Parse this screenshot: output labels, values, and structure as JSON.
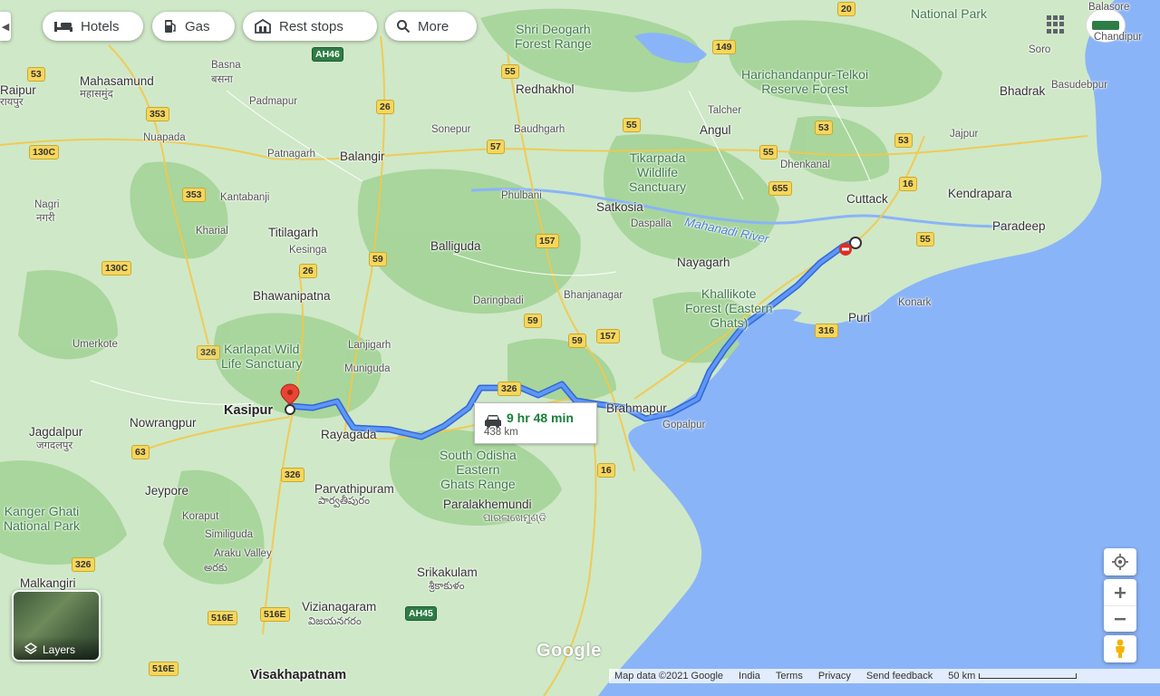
{
  "colors": {
    "land": "#cfe8c8",
    "forest": "#9fd08e",
    "sea": "#8ab4f8",
    "route": "#4a80f5",
    "park_text": "#3d7a4a",
    "duration_green": "#188038"
  },
  "chips": [
    {
      "label": "Hotels",
      "icon": "bed-icon"
    },
    {
      "label": "Gas",
      "icon": "gas-pump-icon"
    },
    {
      "label": "Rest stops",
      "icon": "rest-stop-icon"
    },
    {
      "label": "More",
      "icon": "search-icon"
    }
  ],
  "route": {
    "duration": "9 hr 48 min",
    "distance": "438 km",
    "origin": "Kasipur"
  },
  "places": {
    "kasipur": "Kasipur",
    "rayagada": "Rayagada",
    "brahmapur": "Brahmapur",
    "gopalpur": "Gopalpur",
    "jagdalpur": "Jagdalpur",
    "jagdalpur_local": "जगदलपुर",
    "nowrangpur": "Nowrangpur",
    "jeypore": "Jeypore",
    "koraput": "Koraput",
    "similiguda": "Similiguda",
    "araku_valley": "Araku Valley",
    "araku_local": "అరకు",
    "malkangiri": "Malkangiri",
    "parvathipuram": "Parvathipuram",
    "parvathipuram_local": "పార్వతీపురం",
    "paralakhemundi": "Paralakhemundi",
    "paralakhemundi_local": "ପାରଳାଖେମୁଣ୍ଡି",
    "srikakulam": "Srikakulam",
    "srikakulam_local": "శ్రీకాకుళం",
    "vizianagaram": "Vizianagaram",
    "vizianagaram_local": "విజయనగరం",
    "visakhapatnam": "Visakhapatnam",
    "bhawanipatna": "Bhawanipatna",
    "umerkote": "Umerkote",
    "kharias": "Kharial",
    "titilagarh": "Titilagarh",
    "kesinga": "Kesinga",
    "kantabanji": "Kantabanji",
    "patnagarh": "Patnagarh",
    "balangir": "Balangir",
    "nuapada": "Nuapada",
    "padmapur": "Padmapur",
    "mahasamund": "Mahasamund",
    "mahasamund_local": "महासमुंद",
    "raipur": "Raipur",
    "raipur_local": "रायपुर",
    "nagri": "Nagri",
    "nagri_local": "नगरी",
    "basna": "Basna",
    "basna_local": "बसना",
    "sonepur": "Sonepur",
    "baudhgarh": "Baudhgarh",
    "redhakhol": "Redhakhol",
    "phulbani": "Phulbani",
    "balliguda": "Balliguda",
    "daringbadi": "Daringbadi",
    "bhanjanagar": "Bhanjanagar",
    "satkosia": "Satkosia",
    "daspalla": "Daspalla",
    "nayagarh": "Nayagarh",
    "angul": "Angul",
    "talcher": "Talcher",
    "dhenkanal": "Dhenkanal",
    "cuttack": "Cuttack",
    "kendrapara": "Kendrapara",
    "paradeep": "Paradeep",
    "puri": "Puri",
    "konark": "Konark",
    "bhadrak": "Bhadrak",
    "basudebpur": "Basudebpur",
    "jajpur": "Jajpur",
    "soro": "Soro",
    "balasore": "Balasore",
    "chandipur": "Chandipur",
    "lanjigarh": "Lanjigarh",
    "muniguda": "Muniguda"
  },
  "parks": {
    "karlapat": "Karlapat Wild\nLife Sanctuary",
    "kanger": "Kanger Ghati\nNational Park",
    "south_odisha": "South Odisha\nEastern\nGhats Range",
    "khallikote": "Khallikote\nForest (Eastern\nGhats)",
    "tikarpada": "Tikarpada\nWildlife\nSanctuary",
    "shri_deogarh": "Shri Deogarh\nForest Range",
    "harichandanpur": "Harichandanpur-Telkoi\nReserve Forest",
    "national_park": "National Park"
  },
  "river": "Mahanadi River",
  "highways": [
    "53",
    "353",
    "130C",
    "26",
    "353",
    "130C",
    "26",
    "53",
    "55",
    "55",
    "55",
    "53",
    "53",
    "655",
    "16",
    "55",
    "149",
    "57",
    "157",
    "59",
    "59",
    "59",
    "157",
    "326",
    "326",
    "16",
    "316",
    "63",
    "326",
    "516E",
    "516E",
    "516E",
    "AH45",
    "AH46",
    "20",
    "326"
  ],
  "layers_label": "Layers",
  "footer": {
    "map_data": "Map data ©2021 Google",
    "country": "India",
    "terms": "Terms",
    "privacy": "Privacy",
    "feedback": "Send feedback",
    "scale": "50 km"
  },
  "logo": "Google"
}
